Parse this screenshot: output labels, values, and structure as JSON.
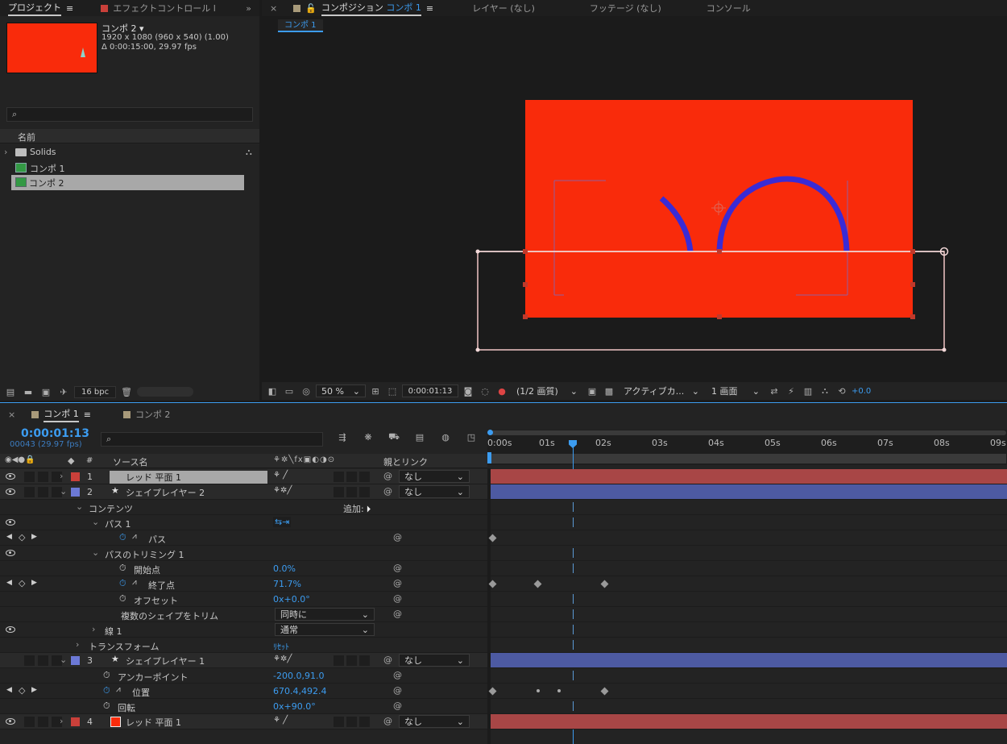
{
  "project": {
    "tab": "プロジェクト",
    "tab2": "エフェクトコントロール l",
    "comp_name": "コンポ 2 ▾",
    "comp_size": "1920 x 1080 (960 x 540) (1.00)",
    "comp_dur": "Δ 0:00:15:00, 29.97 fps",
    "col_name": "名前",
    "items": [
      "Solids",
      "コンポ 1",
      "コンポ 2"
    ],
    "bpc": "16 bpc"
  },
  "viewer": {
    "tab_comp": "コンポジション",
    "tab_comp_name": "コンポ 1",
    "tab_layer": "レイヤー (なし)",
    "tab_footage": "フッテージ (なし)",
    "tab_console": "コンソール",
    "breadcrumb": "コンポ 1",
    "zoom": "50 %",
    "timecode": "0:00:01:13",
    "quality": "(1/2 画質)",
    "camera": "アクティブカ...",
    "views": "1 画面",
    "exposure": "+0.0"
  },
  "colors": {
    "comp_bg": "#f92b0b",
    "stroke": "#3a2bd6",
    "red_label": "#c9403a",
    "blue_label": "#6c79d6"
  },
  "timeline": {
    "tab1": "コンポ 1",
    "tab2": "コンポ 2",
    "timecode": "0:00:01:13",
    "frames": "00043 (29.97 fps)",
    "col_source": "ソース名",
    "col_parent": "親とリンク",
    "col_num": "#",
    "ruler": [
      "0:00s",
      "01s",
      "02s",
      "03s",
      "04s",
      "05s",
      "06s",
      "07s",
      "08s",
      "09s"
    ],
    "rows": {
      "l1_num": "1",
      "l1_name": "レッド 平面 1",
      "l1_parent": "なし",
      "l2_num": "2",
      "l2_name": "シェイプレイヤー 2",
      "l2_parent": "なし",
      "contents": "コンテンツ",
      "add": "追加:",
      "path1": "パス 1",
      "path": "パス",
      "trim": "パスのトリミング 1",
      "start": "開始点",
      "start_v": "0.0%",
      "end": "終了点",
      "end_v": "71.7%",
      "offset": "オフセット",
      "offset_v": "0x+0.0°",
      "multi": "複数のシェイプをトリム",
      "multi_v": "同時に",
      "stroke": "線 1",
      "stroke_v": "通常",
      "transform": "トランスフォーム",
      "reset": "ﾘｾｯﾄ",
      "l3_num": "3",
      "l3_name": "シェイプレイヤー 1",
      "l3_parent": "なし",
      "anchor": "アンカーポイント",
      "anchor_v": "-200.0,91.0",
      "pos": "位置",
      "pos_v": "670.4,492.4",
      "rot": "回転",
      "rot_v": "0x+90.0°",
      "l4_num": "4",
      "l4_name": "レッド 平面 1",
      "l4_parent": "なし"
    }
  }
}
